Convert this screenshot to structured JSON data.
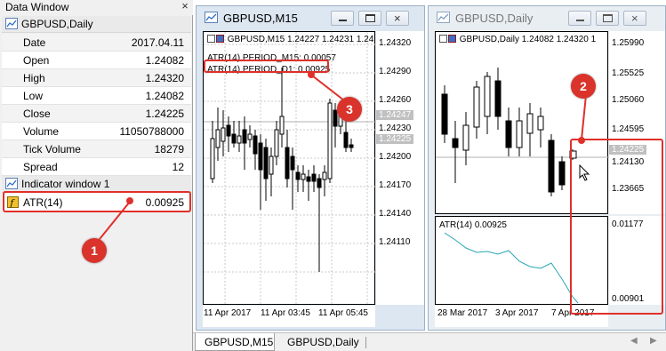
{
  "data_window": {
    "title": "Data Window",
    "symbol_group": "GBPUSD,Daily",
    "rows": [
      {
        "label": "Date",
        "value": "2017.04.11"
      },
      {
        "label": "Open",
        "value": "1.24082"
      },
      {
        "label": "High",
        "value": "1.24320"
      },
      {
        "label": "Low",
        "value": "1.24082"
      },
      {
        "label": "Close",
        "value": "1.24225"
      },
      {
        "label": "Volume",
        "value": "11050788000"
      },
      {
        "label": "Tick Volume",
        "value": "18279"
      },
      {
        "label": "Spread",
        "value": "12"
      }
    ],
    "indicator_group": "Indicator window 1",
    "indicator_row": {
      "label": "ATR(14)",
      "value": "0.00925"
    }
  },
  "chart_m15": {
    "title": "GBPUSD,M15",
    "header": "GBPUSD,M15  1.24227 1.24231 1.24",
    "info_line1": "ATR(14),PERIOD_M15: 0.00057",
    "info_line2": "ATR(14),PERIOD_D1: 0.00925",
    "prices": [
      "1.24320",
      "1.24290",
      "1.24260",
      "1.24247",
      "1.24230",
      "1.24225",
      "1.24200",
      "1.24170",
      "1.24140",
      "1.24110"
    ],
    "dates": [
      "11 Apr 2017",
      "11 Apr 03:45",
      "11 Apr 05:45"
    ]
  },
  "chart_daily": {
    "title": "GBPUSD,Daily",
    "header": "GBPUSD,Daily  1.24082 1.24320 1",
    "prices": [
      "1.25990",
      "1.25525",
      "1.25060",
      "1.24595",
      "1.24225",
      "1.24130",
      "1.23665"
    ],
    "indicator_label": "ATR(14) 0.00925",
    "indicator_prices": [
      "0.01177",
      "0.00901"
    ],
    "dates": [
      "28 Mar 2017",
      "3 Apr 2017",
      "7 Apr 2017"
    ]
  },
  "tabs": [
    "GBPUSD,M15",
    "GBPUSD,Daily"
  ],
  "callouts": [
    "1",
    "2",
    "3"
  ],
  "colors": {
    "callout": "#d9332b",
    "atr_line": "#2aa7b3",
    "price_tag": "#c0c0c0"
  }
}
